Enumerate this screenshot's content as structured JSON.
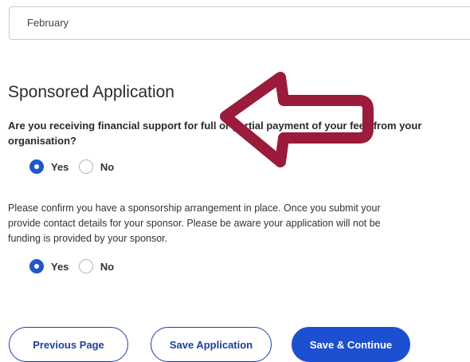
{
  "month_select": {
    "value": "February"
  },
  "section": {
    "title": "Sponsored Application",
    "question_line1": "Are you receiving financial support for full or partial payment of your fees from your",
    "question_line2": "organisation?",
    "confirm_line1": "Please confirm you have a sponsorship arrangement in place. Once you submit your",
    "confirm_line2": "provide contact details for your sponsor. Please be aware your application will not be",
    "confirm_line3": "funding is provided by your sponsor."
  },
  "radio1": {
    "yes": "Yes",
    "no": "No",
    "selected": "Yes"
  },
  "radio2": {
    "yes": "Yes",
    "no": "No",
    "selected": "Yes"
  },
  "buttons": {
    "previous": "Previous Page",
    "save": "Save Application",
    "continue": "Save & Continue"
  },
  "colors": {
    "accent": "#1d4fd1",
    "annotation_arrow": "#9b1b3a"
  },
  "annotation": {
    "icon": "left-arrow-icon"
  }
}
